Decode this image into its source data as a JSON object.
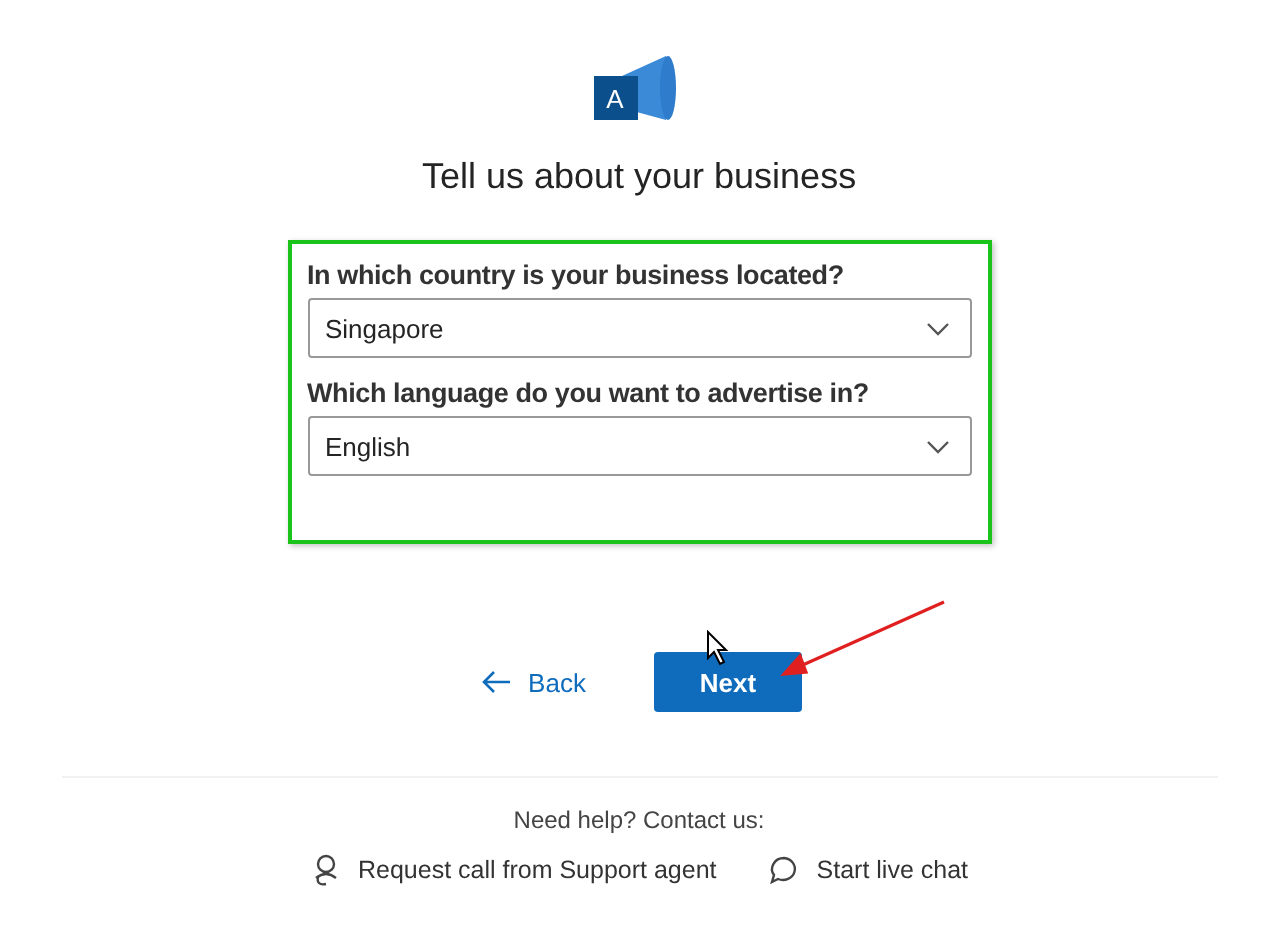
{
  "logo": {
    "letter": "A"
  },
  "title": "Tell us about your business",
  "fields": [
    {
      "label": "In which country is your business located?",
      "value": "Singapore"
    },
    {
      "label": "Which language do you want to advertise in?",
      "value": "English"
    }
  ],
  "back_button": "Back",
  "next_button": "Next",
  "help": {
    "text": "Need help? Contact us:",
    "links": [
      {
        "kind": "call",
        "label": "Request call from Support agent"
      },
      {
        "kind": "chat",
        "label": "Start live chat"
      }
    ]
  }
}
